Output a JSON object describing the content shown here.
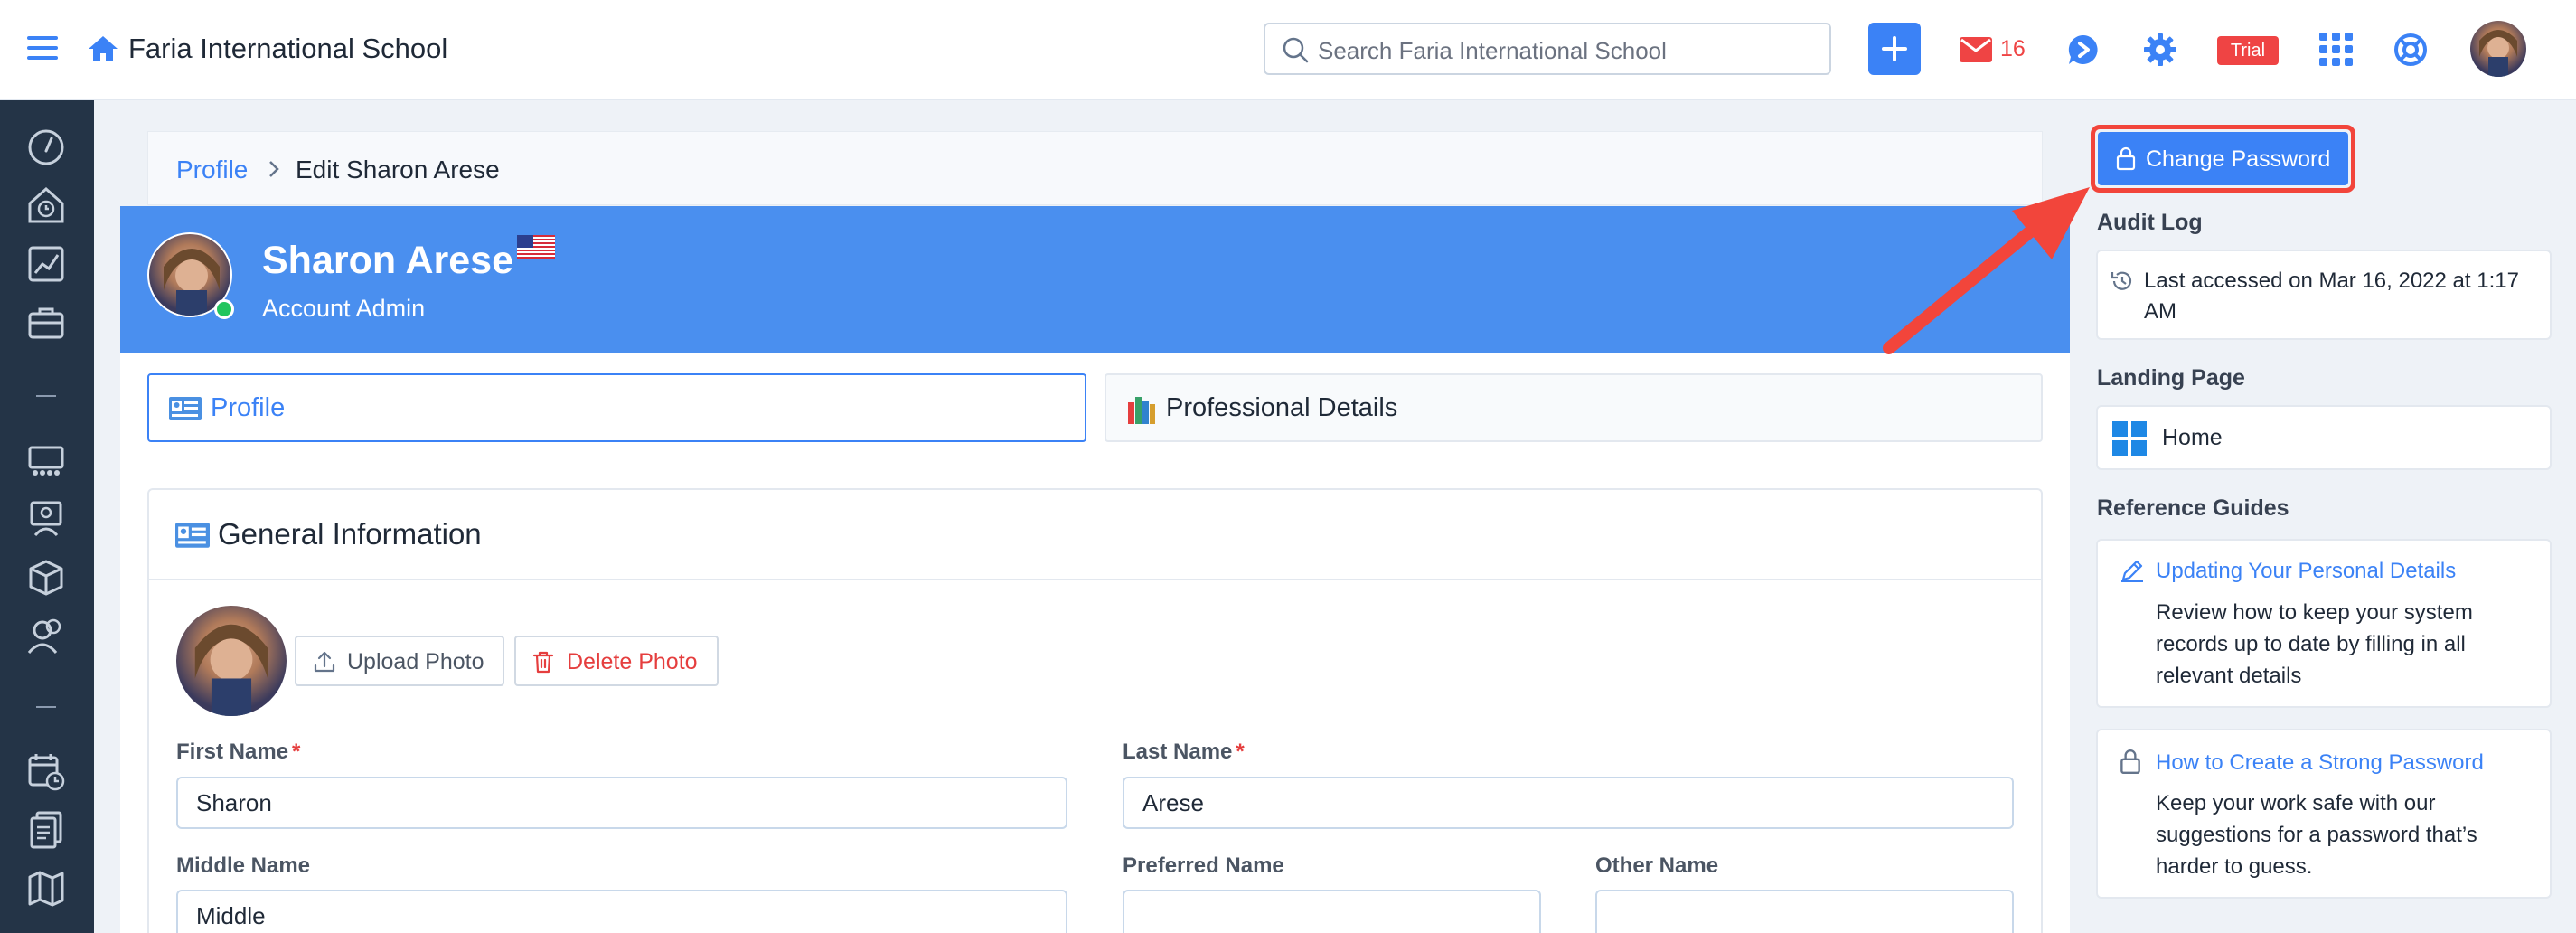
{
  "app": {
    "school_name": "Faria International School",
    "search_placeholder": "Search Faria International School",
    "mail_count": "16",
    "trial_label": "Trial"
  },
  "breadcrumb": {
    "root": "Profile",
    "current": "Edit Sharon Arese"
  },
  "profile_header": {
    "name": "Sharon Arese",
    "role": "Account Admin"
  },
  "tabs": [
    {
      "label": "Profile"
    },
    {
      "label": "Professional Details"
    }
  ],
  "general": {
    "title": "General Information",
    "upload_label": "Upload Photo",
    "delete_label": "Delete Photo",
    "first_name_label": "First Name",
    "first_name": "Sharon",
    "last_name_label": "Last Name",
    "last_name": "Arese",
    "middle_name_label": "Middle Name",
    "middle_name": "Middle",
    "preferred_name_label": "Preferred Name",
    "preferred_name": "",
    "other_name_label": "Other Name",
    "other_name": "",
    "required_mark": "*"
  },
  "right": {
    "change_password_label": "Change Password",
    "audit_log_title": "Audit Log",
    "audit_text": "Last accessed on Mar 16, 2022 at 1:17 AM",
    "landing_title": "Landing Page",
    "landing_value": "Home",
    "guides_title": "Reference Guides",
    "guides": [
      {
        "title": "Updating Your Personal Details",
        "desc": "Review how to keep your system records up to date by filling in all relevant details"
      },
      {
        "title": "How to Create a Strong Password",
        "desc": "Keep your work safe with our suggestions for a password that’s harder to guess."
      }
    ]
  },
  "colors": {
    "brand_blue": "#4a8fef",
    "sidebar": "#243447",
    "danger": "#e53e3e",
    "highlight": "#f2453b"
  }
}
